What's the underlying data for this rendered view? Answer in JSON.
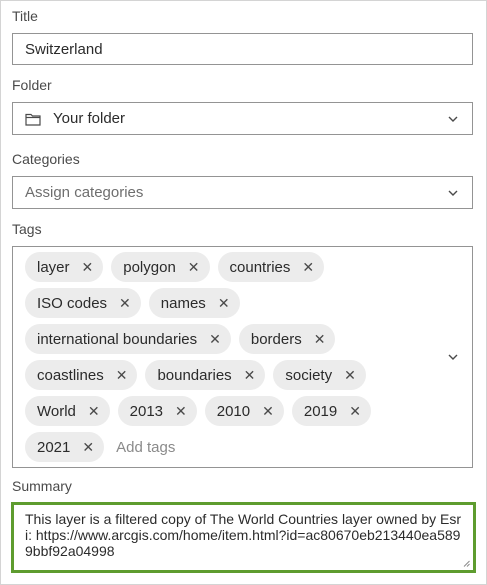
{
  "title_field": {
    "label": "Title",
    "value": "Switzerland"
  },
  "folder_field": {
    "label": "Folder",
    "value": "Your folder"
  },
  "categories_field": {
    "label": "Categories",
    "placeholder": "Assign categories"
  },
  "tags_field": {
    "label": "Tags",
    "remove_glyph": "✕",
    "add_placeholder": "Add tags",
    "rows": [
      [
        "layer",
        "polygon",
        "countries"
      ],
      [
        "ISO codes",
        "names"
      ],
      [
        "international boundaries",
        "borders"
      ],
      [
        "coastlines",
        "boundaries",
        "society"
      ],
      [
        "World",
        "2013",
        "2010",
        "2019"
      ],
      [
        "2021"
      ]
    ]
  },
  "summary_field": {
    "label": "Summary",
    "value": "This layer is a filtered copy of The World Countries layer owned by Esri: https://www.arcgis.com/home/item.html?id=ac80670eb213440ea5899bbf92a04998",
    "focus_border_color": "#5e9c2f"
  },
  "icons": {
    "folder": "folder-icon",
    "dropdown": "chevron-down-icon",
    "remove": "close-icon",
    "resize": "resize-grip-icon"
  }
}
